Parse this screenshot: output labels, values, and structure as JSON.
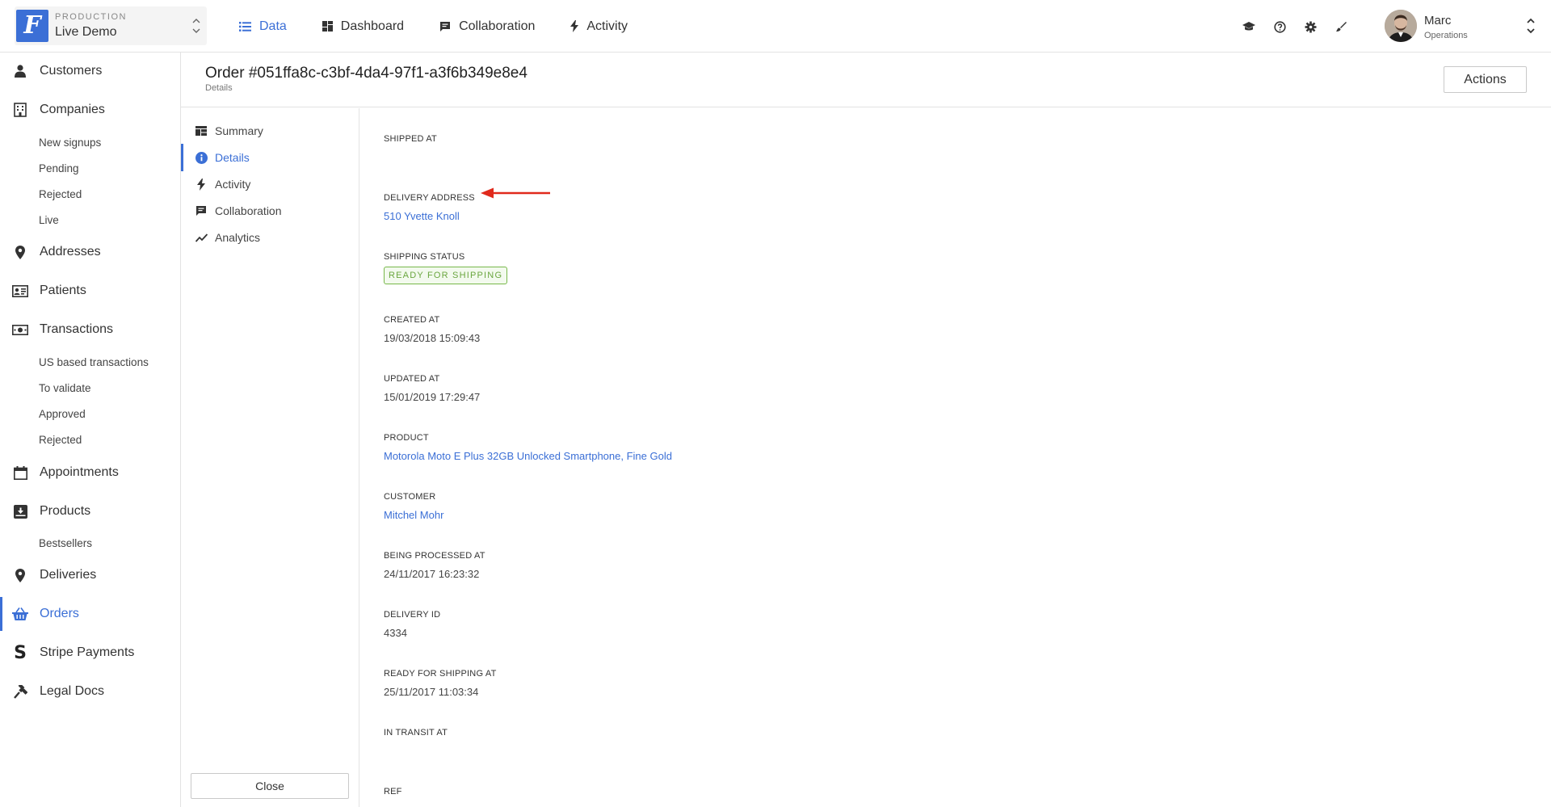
{
  "env": {
    "label": "PRODUCTION",
    "name": "Live Demo",
    "logo_letter": "F"
  },
  "topnav": [
    {
      "label": "Data",
      "icon": "list-icon",
      "active": true
    },
    {
      "label": "Dashboard",
      "icon": "dashboard-icon",
      "active": false
    },
    {
      "label": "Collaboration",
      "icon": "chat-icon",
      "active": false
    },
    {
      "label": "Activity",
      "icon": "bolt-icon",
      "active": false
    }
  ],
  "tools": [
    "graduation-cap-icon",
    "help-icon",
    "gear-icon",
    "brush-icon"
  ],
  "user": {
    "name": "Marc",
    "role": "Operations"
  },
  "sidebar": {
    "customers": "Customers",
    "companies": "Companies",
    "companies_sub": [
      "New signups",
      "Pending",
      "Rejected",
      "Live"
    ],
    "addresses": "Addresses",
    "patients": "Patients",
    "transactions": "Transactions",
    "transactions_sub": [
      "US based transactions",
      "To validate",
      "Approved",
      "Rejected"
    ],
    "appointments": "Appointments",
    "products": "Products",
    "products_sub": [
      "Bestsellers"
    ],
    "deliveries": "Deliveries",
    "orders": "Orders",
    "stripe": "Stripe Payments",
    "legal": "Legal Docs"
  },
  "page": {
    "title": "Order #051ffa8c-c3bf-4da4-97f1-a3f6b349e8e4",
    "subtitle": "Details",
    "actions_label": "Actions"
  },
  "subnav": {
    "summary": "Summary",
    "details": "Details",
    "activity": "Activity",
    "collaboration": "Collaboration",
    "analytics": "Analytics",
    "close_label": "Close"
  },
  "fields": {
    "shipped_at": {
      "label": "Shipped at",
      "value": ""
    },
    "delivery_address": {
      "label": "Delivery address",
      "value": "510 Yvette Knoll"
    },
    "shipping_status": {
      "label": "Shipping status",
      "value": "Ready for shipping"
    },
    "created_at": {
      "label": "Created at",
      "value": "19/03/2018 15:09:43"
    },
    "updated_at": {
      "label": "Updated at",
      "value": "15/01/2019 17:29:47"
    },
    "product": {
      "label": "Product",
      "value": "Motorola Moto E Plus 32GB Unlocked Smartphone, Fine Gold"
    },
    "customer": {
      "label": "Customer",
      "value": "Mitchel Mohr"
    },
    "being_processed_at": {
      "label": "Being processed at",
      "value": "24/11/2017 16:23:32"
    },
    "delivery_id": {
      "label": "Delivery ID",
      "value": "4334"
    },
    "ready_for_shipping_at": {
      "label": "Ready for shipping at",
      "value": "25/11/2017 11:03:34"
    },
    "in_transit_at": {
      "label": "In transit at",
      "value": ""
    },
    "ref": {
      "label": "Ref",
      "value": ""
    }
  },
  "colors": {
    "accent": "#3b6fd6",
    "status_green": "#6aa63f",
    "annotation_red": "#e02a1c"
  }
}
